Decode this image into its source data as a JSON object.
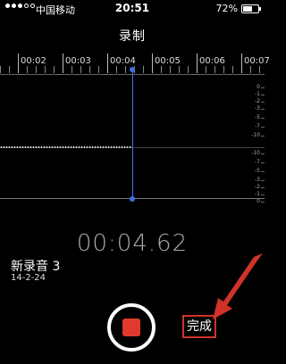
{
  "status_bar": {
    "carrier": "中国移动",
    "time": "20:51",
    "battery_percent": "72%",
    "battery_level": 0.72
  },
  "screen": {
    "title": "录制"
  },
  "timeline": {
    "labels": [
      "00:02",
      "00:03",
      "00:04",
      "00:05",
      "00:06",
      "00:07"
    ]
  },
  "meter": {
    "db_labels": [
      "0",
      "-1",
      "-2",
      "-3",
      "-5",
      "-7",
      "-10",
      "-10",
      "-7",
      "-5",
      "-3",
      "-2",
      "-1",
      "0"
    ]
  },
  "recording": {
    "elapsed": "00:04.62",
    "name": "新录音 3",
    "date": "14-2-24"
  },
  "controls": {
    "done_label": "完成"
  },
  "colors": {
    "accent": "#3f6fe0",
    "record": "#e03a2f",
    "annotation": "#d0322a"
  }
}
